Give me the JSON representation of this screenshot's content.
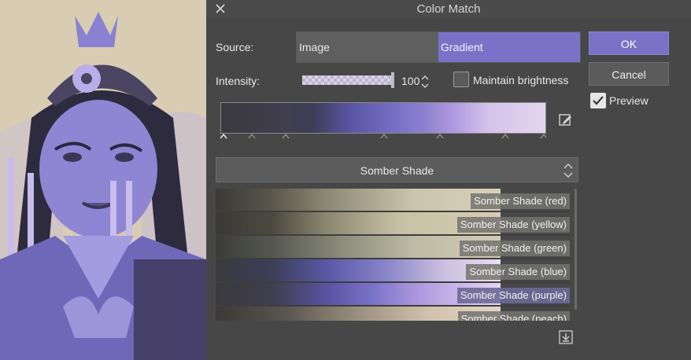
{
  "dialog": {
    "title": "Color Match",
    "source_label": "Source:",
    "source_options": [
      "Image",
      "Gradient"
    ],
    "source_selected": "Gradient",
    "intensity_label": "Intensity:",
    "intensity_value": "100",
    "maintain_brightness_label": "Maintain brightness",
    "maintain_brightness_checked": false,
    "ok_label": "OK",
    "cancel_label": "Cancel",
    "preview_label": "Preview",
    "preview_checked": true,
    "preset_selected": "Somber Shade",
    "presets": [
      "Somber Shade (red)",
      "Somber Shade (yellow)",
      "Somber Shade (green)",
      "Somber Shade (blue)",
      "Somber Shade (purple)",
      "Somber Shade (peach)"
    ]
  },
  "colors": {
    "accent": "#7b72c7",
    "dialog_bg": "#474747"
  },
  "icons": [
    "close-icon",
    "eyedropper-icon",
    "import-icon",
    "chevron-updown-icon",
    "checkmark-icon"
  ]
}
